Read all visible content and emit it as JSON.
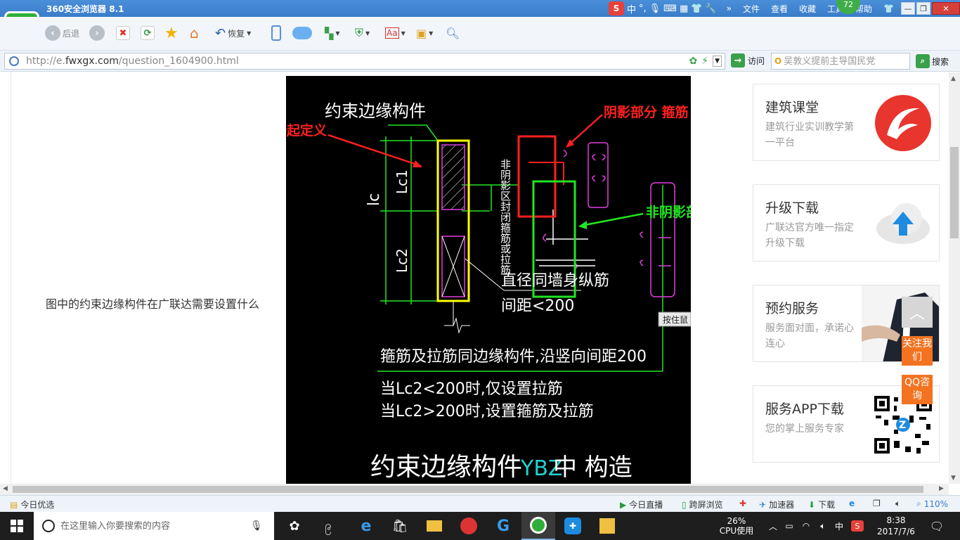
{
  "window": {
    "title": "360安全浏览器 8.1",
    "menu": [
      "文件",
      "查看",
      "收藏",
      "工具",
      "帮助"
    ],
    "badge": "72",
    "ime": {
      "zh": "中",
      "punct": "°,"
    }
  },
  "toolbar": {
    "back_label": "后退",
    "restore_label": "恢复"
  },
  "addressbar": {
    "url_prefix": "http://e.",
    "url_domain": "fwxgx.com",
    "url_path": "/question_1604900.html",
    "visit_label": "访问",
    "search_placeholder": "吴敦义提前主导国民党",
    "search_button": "搜索"
  },
  "main": {
    "question_text": "图中的约束边缘构件在广联达需要设置什么",
    "image_tooltip": "按住鼠"
  },
  "drawing": {
    "title_label": "约束边缘构件",
    "annot_shaded_and_unshaded": "阴影和非阴影一起定义",
    "annot_shaded_stirrup": "阴影部分 箍筋",
    "annot_unshaded_stirrup": "非阴影部分箍筋",
    "lc": "lc",
    "lc1": "Lc1",
    "lc2": "Lc2",
    "vertical_note": "非阴影区封闭箍筋或拉筋",
    "diameter_note": "直径同墙身纵筋",
    "spacing_note": "间距<200",
    "note_line1": "箍筋及拉筋同边缘构件,沿竖向间距200",
    "note_line2": "当Lc2<200时,仅设置拉筋",
    "note_line3": "当Lc2>200时,设置箍筋及拉筋",
    "bottom_title": "约束边缘构件",
    "bottom_code": "YBZ",
    "bottom_suffix": "中  构造"
  },
  "sidebar": {
    "cards": [
      {
        "title": "建筑课堂",
        "subtitle": "建筑行业实训教学第一平台"
      },
      {
        "title": "升级下载",
        "subtitle": "广联达官方唯一指定升级下载"
      },
      {
        "title": "预约服务",
        "subtitle": "服务面对面，承诺心连心"
      },
      {
        "title": "服务APP下载",
        "subtitle": "您的掌上服务专家"
      }
    ],
    "follow_label": "关注我们",
    "qq_label": "QQ咨询"
  },
  "statusbar": {
    "left": "今日优选",
    "live": "今日直播",
    "cross_screen": "跨屏浏览",
    "accelerator": "加速器",
    "download": "下载",
    "zoom": "110%"
  },
  "taskbar": {
    "search_placeholder": "在这里输入你要搜索的内容",
    "cpu_percent": "26%",
    "cpu_label": "CPU使用",
    "ime": "中",
    "time": "8:38",
    "date": "2017/7/6"
  },
  "colors": {
    "annotation_red": "#ff2020",
    "annotation_green": "#22e622",
    "cad_yellow": "#ffff00",
    "cad_magenta": "#e040e0",
    "accent_orange": "#f37321",
    "browser_green": "#2fae3a"
  }
}
